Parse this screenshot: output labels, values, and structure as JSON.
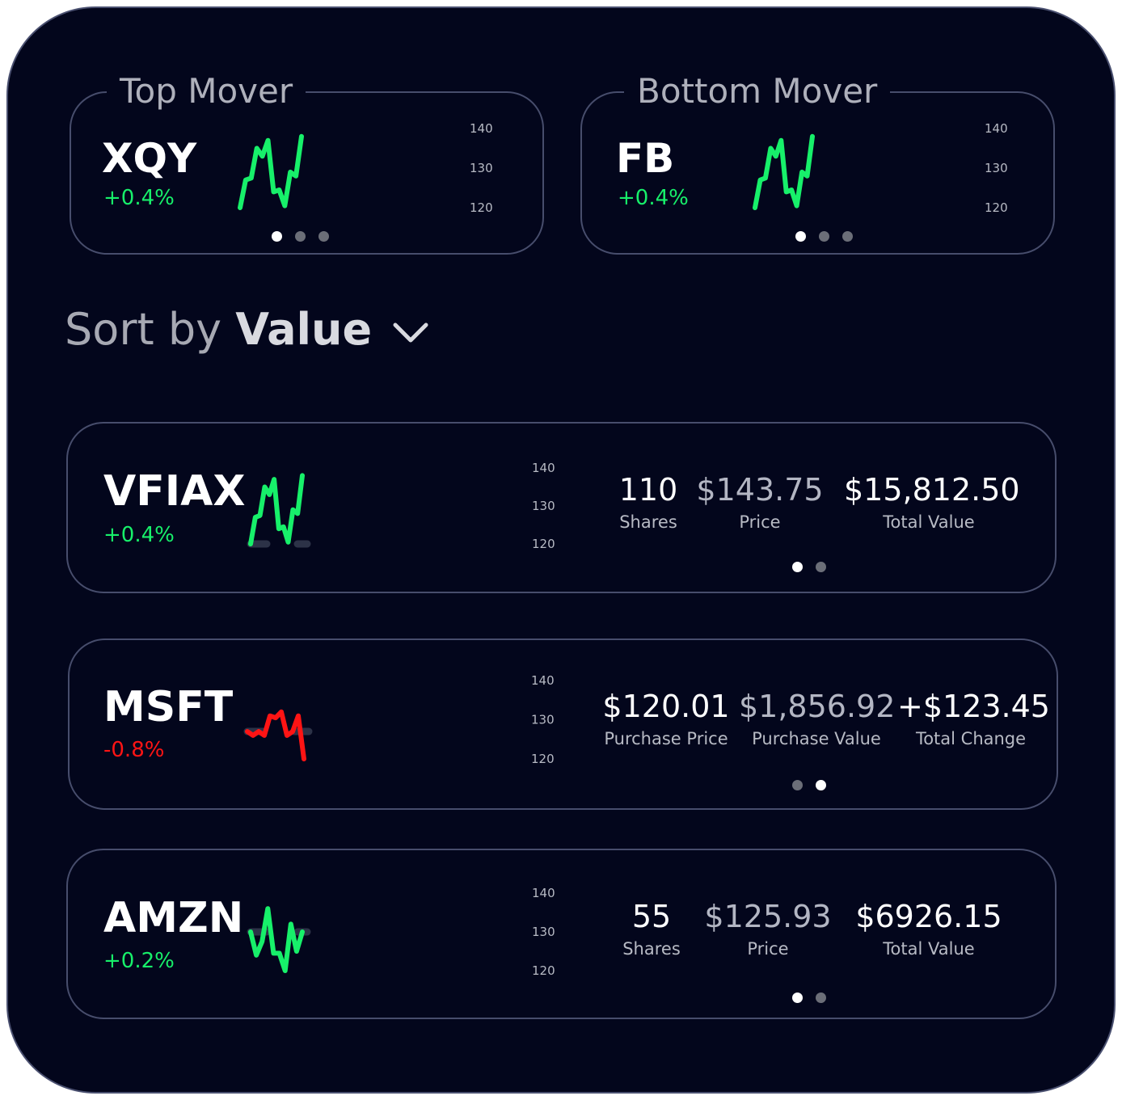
{
  "top_mover": {
    "label": "Top Mover",
    "ticker": "XQY",
    "change": "+0.4%",
    "ticks": [
      "140",
      "130",
      "120"
    ],
    "spark": [
      120,
      127,
      127.5,
      135,
      133,
      137,
      124,
      124.5,
      120.5,
      129,
      128,
      138
    ]
  },
  "bottom_mover": {
    "label": "Bottom Mover",
    "ticker": "FB",
    "change": "+0.4%",
    "ticks": [
      "140",
      "130",
      "120"
    ],
    "spark": [
      120,
      127,
      127.5,
      135,
      133,
      137,
      124,
      124.5,
      120.5,
      129,
      128,
      138
    ]
  },
  "sort": {
    "prefix": "Sort by",
    "value": "Value"
  },
  "holdings": [
    {
      "ticker": "VFIAX",
      "change": "+0.4%",
      "trend": "up",
      "ticks": [
        "140",
        "130",
        "120"
      ],
      "spark": [
        120,
        127,
        127.5,
        135,
        133,
        137,
        124,
        124.5,
        120.5,
        129,
        128,
        138
      ],
      "stats": [
        {
          "value": "110",
          "label": "Shares"
        },
        {
          "value": "$143.75",
          "label": "Price"
        },
        {
          "value": "$15,812.50",
          "label": "Total Value"
        }
      ],
      "page": 1
    },
    {
      "ticker": "MSFT",
      "change": "-0.8%",
      "trend": "down",
      "ticks": [
        "140",
        "130",
        "120"
      ],
      "spark": [
        127,
        126,
        127,
        126,
        131,
        130.5,
        132,
        126,
        127,
        131,
        120
      ],
      "stats": [
        {
          "value": "$120.01",
          "label": "Purchase Price"
        },
        {
          "value": "$1,856.92",
          "label": "Purchase Value"
        },
        {
          "value": "+$123.45",
          "label": "Total Change"
        }
      ],
      "page": 2
    },
    {
      "ticker": "AMZN",
      "change": "+0.2%",
      "trend": "up",
      "ticks": [
        "140",
        "130",
        "120"
      ],
      "spark": [
        130,
        124,
        127.5,
        136,
        124.5,
        124.5,
        120,
        132,
        125,
        130
      ],
      "stats": [
        {
          "value": "55",
          "label": "Shares"
        },
        {
          "value": "$125.93",
          "label": "Price"
        },
        {
          "value": "$6926.15",
          "label": "Total Value"
        }
      ],
      "page": 1
    }
  ],
  "colors": {
    "positive": "#17f06a",
    "negative": "#ff1414",
    "background": "#03061c"
  }
}
